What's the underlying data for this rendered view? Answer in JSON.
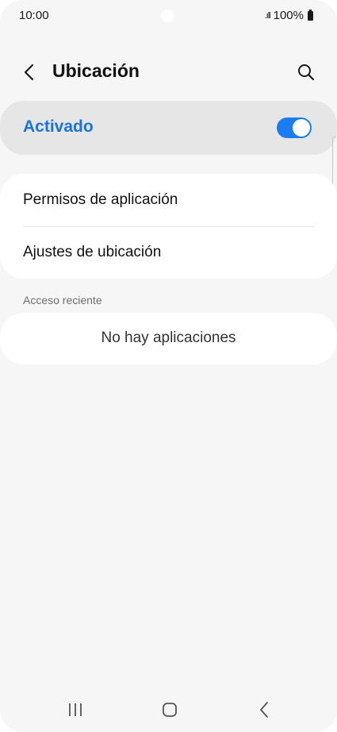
{
  "status_bar": {
    "time": "10:00",
    "signal": ".ıll",
    "battery": "100%"
  },
  "header": {
    "title": "Ubicación"
  },
  "master_toggle": {
    "label": "Activado",
    "state": "on",
    "accent_color": "#1a73d9"
  },
  "options": [
    {
      "label": "Permisos de aplicación"
    },
    {
      "label": "Ajustes de ubicación"
    }
  ],
  "recent_access": {
    "header": "Acceso reciente",
    "empty_text": "No hay aplicaciones"
  },
  "icons": {
    "back": "back-arrow-icon",
    "search": "search-icon",
    "nav_recents": "recents-icon",
    "nav_home": "home-icon",
    "nav_back": "nav-back-icon"
  }
}
